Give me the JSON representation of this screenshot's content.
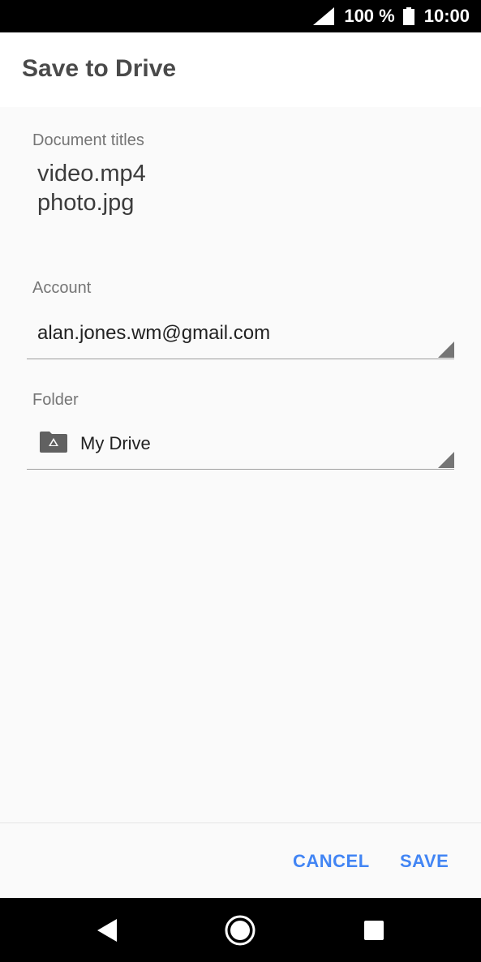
{
  "status_bar": {
    "battery_percent": "100 %",
    "time": "10:00",
    "icons": [
      "signal-icon",
      "battery-icon"
    ]
  },
  "app_bar": {
    "title": "Save to Drive"
  },
  "form": {
    "document_titles_label": "Document titles",
    "documents": [
      "video.mp4",
      "photo.jpg"
    ],
    "account_label": "Account",
    "account_value": "alan.jones.wm@gmail.com",
    "folder_label": "Folder",
    "folder_value": "My Drive",
    "folder_icon": "drive-folder-icon"
  },
  "actions": {
    "cancel_label": "CANCEL",
    "save_label": "SAVE"
  },
  "nav_bar": {
    "icons": [
      "back-icon",
      "home-icon",
      "recents-icon"
    ]
  },
  "colors": {
    "accent": "#4285f4",
    "background": "#fafafa",
    "status_bar": "#000000"
  }
}
